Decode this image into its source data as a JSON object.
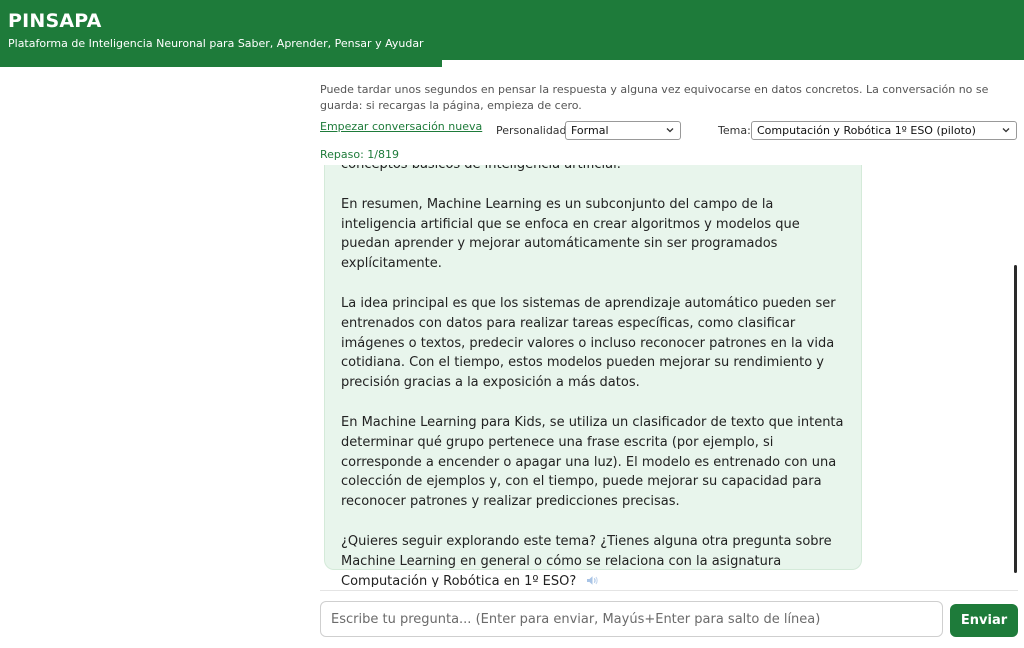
{
  "header": {
    "title": "PINSAPA",
    "subtitle": "Plataforma de Inteligencia Neuronal para Saber, Aprender, Pensar y Ayudar"
  },
  "notice": "Puede tardar unos segundos en pensar la respuesta y alguna vez equivocarse en datos concretos. La conversación no se guarda: si recargas la página, empieza de cero.",
  "controls": {
    "new_conversation": "Empezar conversación nueva",
    "personality_label": "Personalidad:",
    "personality_value": "Formal",
    "topic_label": "Tema:",
    "topic_value": "Computación y Robótica 1º ESO (piloto)"
  },
  "repaso": "Repaso: 1/819",
  "message": {
    "paragraphs": [
      "conceptos básicos de inteligencia artificial.",
      "En resumen, Machine Learning es un subconjunto del campo de la inteligencia artificial que se enfoca en crear algoritmos y modelos que puedan aprender y mejorar automáticamente sin ser programados explícitamente.",
      "La idea principal es que los sistemas de aprendizaje automático pueden ser entrenados con datos para realizar tareas específicas, como clasificar imágenes o textos, predecir valores o incluso reconocer patrones en la vida cotidiana. Con el tiempo, estos modelos pueden mejorar su rendimiento y precisión gracias a la exposición a más datos.",
      "En Machine Learning para Kids, se utiliza un clasificador de texto que intenta determinar qué grupo pertenece una frase escrita (por ejemplo, si corresponde a encender o apagar una luz). El modelo es entrenado con una colección de ejemplos y, con el tiempo, puede mejorar su capacidad para reconocer patrones y realizar predicciones precisas.",
      "¿Quieres seguir explorando este tema? ¿Tienes alguna otra pregunta sobre Machine Learning en general o cómo se relaciona con la asignatura Computación y Robótica en 1º ESO?"
    ],
    "speaker_icon": "speaker-icon"
  },
  "composer": {
    "placeholder": "Escribe tu pregunta... (Enter para enviar, Mayús+Enter para salto de línea)",
    "send_label": "Enviar"
  },
  "colors": {
    "brand": "#1e7b3a",
    "bubble": "#e8f5ec"
  }
}
